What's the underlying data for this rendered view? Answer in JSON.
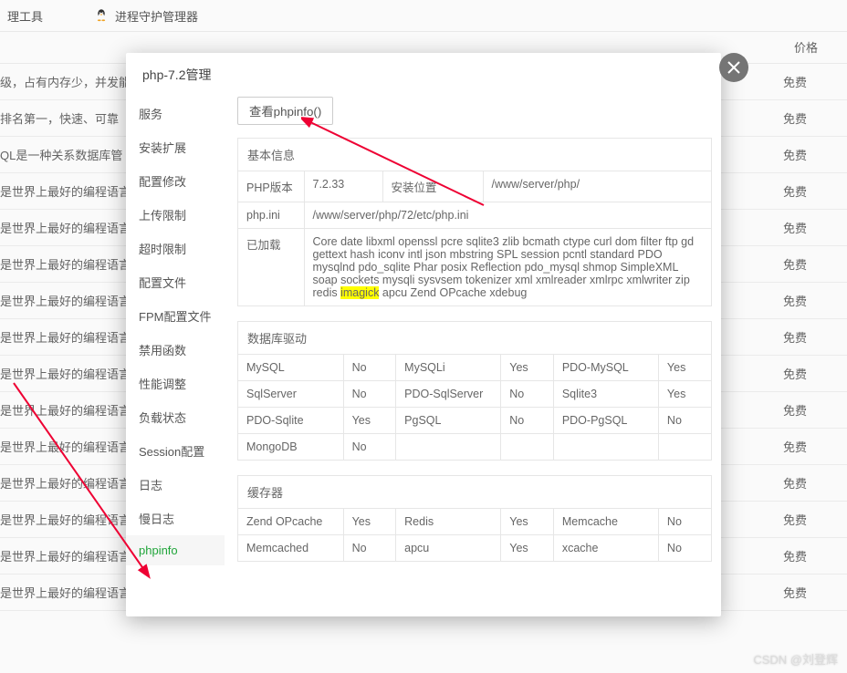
{
  "bgHeader": {
    "item1": "理工具",
    "item2": "进程守护管理器"
  },
  "bgHeaderCol": "价格",
  "bgRows": [
    {
      "desc": "级，占有内存少，并发能",
      "price": "免费"
    },
    {
      "desc": "排名第一，快速、可靠",
      "price": "免费"
    },
    {
      "desc": "QL是一种关系数据库管",
      "price": "免费"
    },
    {
      "desc": "是世界上最好的编程语言",
      "price": "免费"
    },
    {
      "desc": "是世界上最好的编程语言",
      "price": "免费"
    },
    {
      "desc": "是世界上最好的编程语言",
      "price": "免费"
    },
    {
      "desc": "是世界上最好的编程语言",
      "price": "免费"
    },
    {
      "desc": "是世界上最好的编程语言",
      "price": "免费"
    },
    {
      "desc": "是世界上最好的编程语言",
      "price": "免费"
    },
    {
      "desc": "是世界上最好的编程语言",
      "price": "免费"
    },
    {
      "desc": "是世界上最好的编程语言",
      "price": "免费"
    },
    {
      "desc": "是世界上最好的编程语言",
      "price": "免费"
    },
    {
      "desc": "是世界上最好的编程语言",
      "price": "免费"
    },
    {
      "desc": "是世界上最好的编程语言",
      "price": "免费"
    },
    {
      "desc": "是世界上最好的编程语言",
      "price": "免费"
    }
  ],
  "modal": {
    "title": "php-7.2管理",
    "sidebar": [
      "服务",
      "安装扩展",
      "配置修改",
      "上传限制",
      "超时限制",
      "配置文件",
      "FPM配置文件",
      "禁用函数",
      "性能调整",
      "负载状态",
      "Session配置",
      "日志",
      "慢日志",
      "phpinfo"
    ],
    "activeIndex": 13,
    "btnLabel": "查看phpinfo()",
    "basic": {
      "title": "基本信息",
      "phpVerLabel": "PHP版本",
      "phpVer": "7.2.33",
      "installLabel": "安装位置",
      "installPath": "/www/server/php/",
      "iniLabel": "php.ini",
      "iniPath": "/www/server/php/72/etc/php.ini",
      "loadedLabel": "已加载",
      "loadedPre": "Core date libxml openssl pcre sqlite3 zlib bcmath ctype curl dom filter ftp gd gettext hash iconv intl json mbstring SPL session pcntl standard PDO mysqlnd pdo_sqlite Phar posix Reflection pdo_mysql shmop SimpleXML soap sockets mysqli sysvsem tokenizer xml xmlreader xmlrpc xmlwriter zip redis ",
      "loadedHl": "imagick",
      "loadedPost": " apcu Zend OPcache xdebug"
    },
    "db": {
      "title": "数据库驱动",
      "rows": [
        [
          "MySQL",
          "No",
          "MySQLi",
          "Yes",
          "PDO-MySQL",
          "Yes"
        ],
        [
          "SqlServer",
          "No",
          "PDO-SqlServer",
          "No",
          "Sqlite3",
          "Yes"
        ],
        [
          "PDO-Sqlite",
          "Yes",
          "PgSQL",
          "No",
          "PDO-PgSQL",
          "No"
        ],
        [
          "MongoDB",
          "No",
          "",
          "",
          "",
          ""
        ]
      ]
    },
    "cache": {
      "title": "缓存器",
      "rows": [
        [
          "Zend OPcache",
          "Yes",
          "Redis",
          "Yes",
          "Memcache",
          "No"
        ],
        [
          "Memcached",
          "No",
          "apcu",
          "Yes",
          "xcache",
          "No"
        ]
      ]
    }
  },
  "watermark": "CSDN @刘登辉"
}
